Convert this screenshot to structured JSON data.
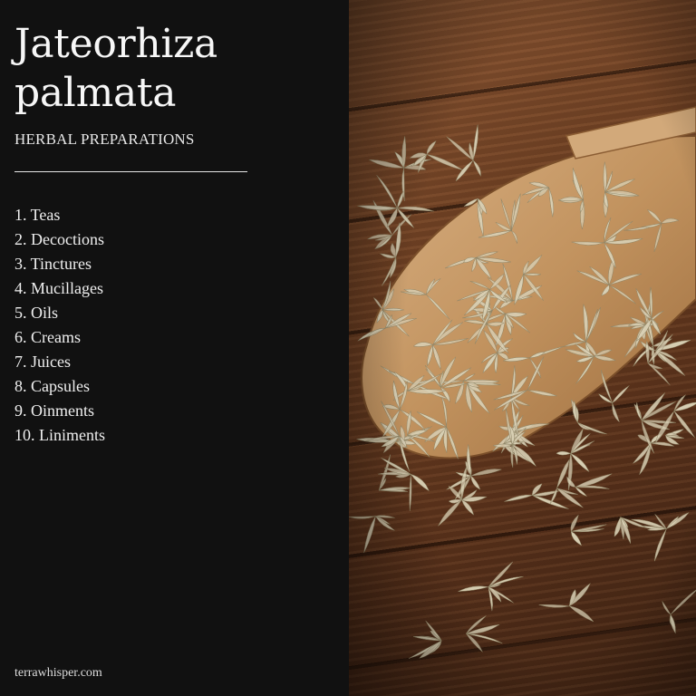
{
  "title": "Jateorhiza palmata",
  "subtitle": "HERBAL PREPARATIONS",
  "preparations": [
    "1. Teas",
    "2. Decoctions",
    "3. Tinctures",
    "4. Mucillages",
    "5. Oils",
    "6. Creams",
    "7. Juices",
    "8. Capsules",
    "9. Oinments",
    "10. Liniments"
  ],
  "footer": "terrawhisper.com",
  "photo": {
    "subject": "dried-herb-on-wooden-scoop",
    "colors": {
      "wood": "#6d3f22",
      "scoop": "#c79a6a",
      "herb": "#d8cfb4"
    }
  }
}
